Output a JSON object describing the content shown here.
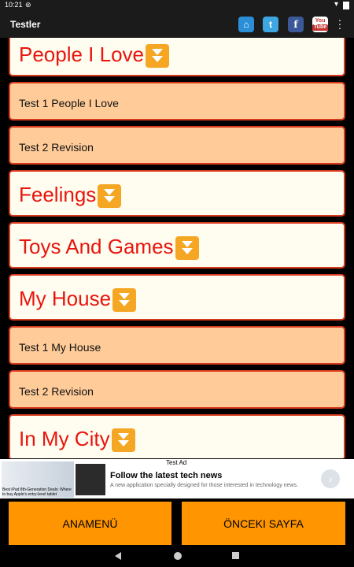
{
  "statusbar": {
    "time": "10:21"
  },
  "toolbar": {
    "title": "Testler",
    "icons": {
      "home": "home-icon",
      "twitter": "t",
      "facebook": "f",
      "youtube_top": "You",
      "youtube_bottom": "Tube"
    }
  },
  "list": {
    "items": [
      {
        "type": "header",
        "label": "People I Love"
      },
      {
        "type": "sub",
        "label": "Test 1 People I Love"
      },
      {
        "type": "sub",
        "label": "Test 2 Revision"
      },
      {
        "type": "header",
        "label": "Feelings"
      },
      {
        "type": "header",
        "label": "Toys And Games"
      },
      {
        "type": "header",
        "label": "My House"
      },
      {
        "type": "sub",
        "label": "Test 1 My House"
      },
      {
        "type": "sub",
        "label": "Test 2 Revision"
      },
      {
        "type": "header",
        "label": "In My City"
      }
    ]
  },
  "ad": {
    "label": "Test Ad",
    "thumb_text": "Best iPad 8th-Generation Deals: Where to buy Apple's entry-level tablet",
    "title": "Follow the latest tech news",
    "description": "A new application specially designed for those interested in technology news."
  },
  "buttons": {
    "home": "ANAMENÜ",
    "previous": "ÖNCEKI SAYFA"
  },
  "colors": {
    "header_text": "#e8150f",
    "border": "#d83a1e",
    "sub_bg": "#ffcc99",
    "header_bg": "#fffdf0",
    "button_bg": "#ff9500"
  }
}
